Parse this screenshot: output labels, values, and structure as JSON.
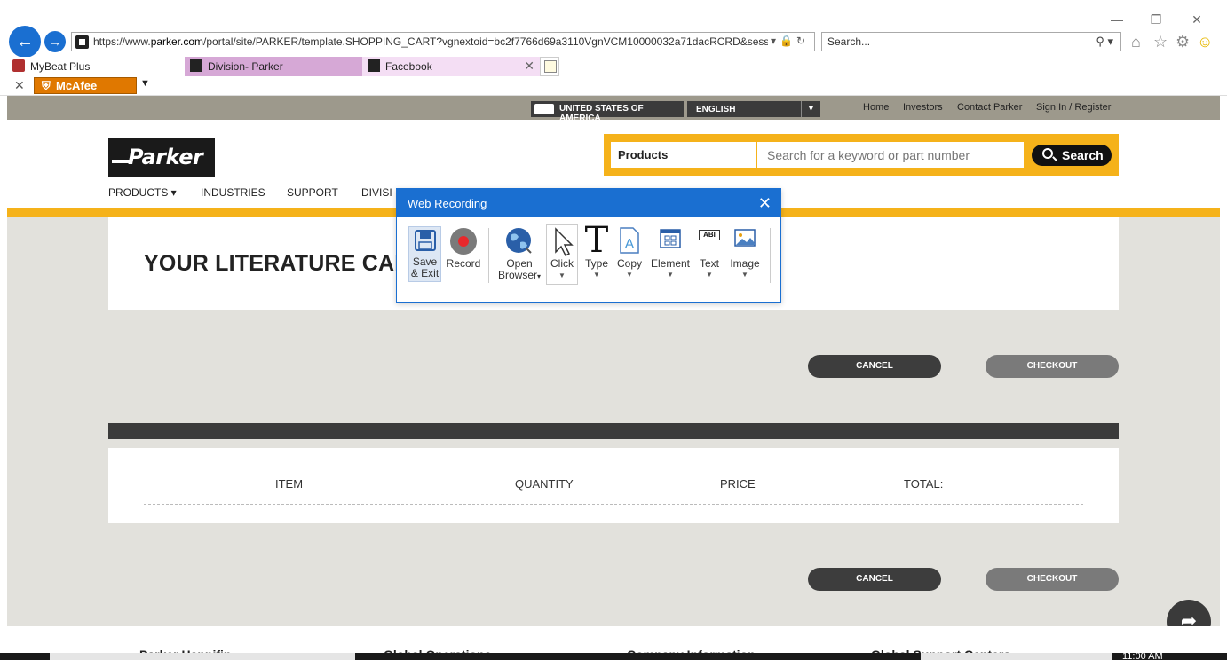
{
  "browser": {
    "url_prefix": "https://www.",
    "url_domain": "parker.com",
    "url_rest": "/portal/site/PARKER/template.SHOPPING_CART?vgnextoid=bc2f7766d69a3110VgnVCM10000032a71dacRCRD&sessionId",
    "search_placeholder": "Search...",
    "tabs": [
      {
        "label": "MyBeat Plus"
      },
      {
        "label": "Division- Parker"
      },
      {
        "label": "Facebook"
      }
    ],
    "mcafee_label": "McAfee",
    "accent": "#1a6fd1"
  },
  "site": {
    "topbar": {
      "country": "UNITED STATES OF AMERICA",
      "language": "ENGLISH",
      "links": [
        "Home",
        "Investors",
        "Contact Parker",
        "Sign In / Register"
      ]
    },
    "logo_text": "Parker",
    "search": {
      "category": "Products",
      "placeholder": "Search for a keyword or part number",
      "button": "Search"
    },
    "nav": [
      "PRODUCTS",
      "INDUSTRIES",
      "SUPPORT",
      "DIVISI"
    ],
    "page_title": "YOUR LITERATURE CAR",
    "buttons": {
      "cancel": "CANCEL",
      "checkout": "CHECKOUT"
    },
    "table_headers": [
      "ITEM",
      "QUANTITY",
      "PRICE",
      "TOTAL:"
    ],
    "footer_headings": [
      "Parker Hannifin",
      "Global Operations",
      "Company Information",
      "Global Support Centers"
    ],
    "brand_color": "#f5b21a"
  },
  "dialog": {
    "title": "Web Recording",
    "tools": [
      {
        "name": "save-exit",
        "label1": "Save",
        "label2": "& Exit"
      },
      {
        "name": "record",
        "label1": "Record"
      },
      {
        "name": "open-browser",
        "label1": "Open",
        "label2": "Browser"
      },
      {
        "name": "click",
        "label1": "Click"
      },
      {
        "name": "type",
        "label1": "Type"
      },
      {
        "name": "copy",
        "label1": "Copy"
      },
      {
        "name": "element",
        "label1": "Element"
      },
      {
        "name": "text",
        "label1": "Text"
      },
      {
        "name": "image",
        "label1": "Image"
      }
    ],
    "text_icon_glyph": "ABI"
  },
  "taskbar_time": "11:00 AM"
}
